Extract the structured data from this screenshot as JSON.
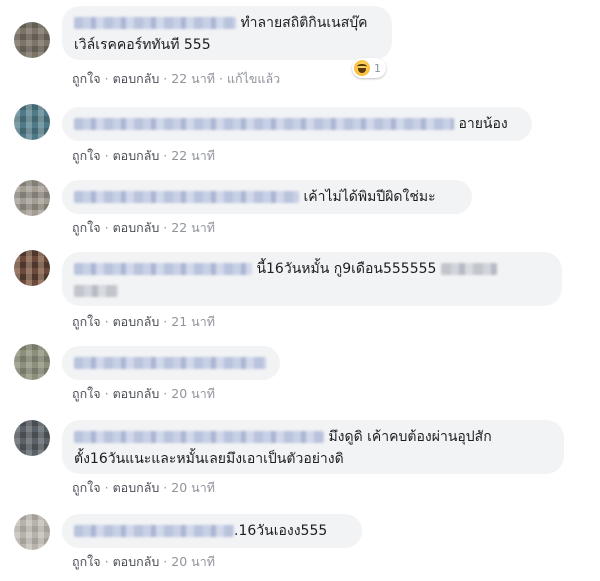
{
  "comments": [
    {
      "text_line1": "ทำลายสถิติกินเนสบุ๊ค",
      "text_line2": "เวิล์เรคคอร์ททันที 555",
      "like": "ถูกใจ",
      "reply": "ตอบกลับ",
      "time": "22 นาที",
      "edited": "แก้ไขแล้ว",
      "reaction_count": "1",
      "reaction_icon": "haha-emoji-icon"
    },
    {
      "text": "อายน้อง",
      "like": "ถูกใจ",
      "reply": "ตอบกลับ",
      "time": "22 นาที"
    },
    {
      "text": "เค้าไม่ได้พิมปีผิดใช่มะ",
      "like": "ถูกใจ",
      "reply": "ตอบกลับ",
      "time": "22 นาที"
    },
    {
      "text": "นี้16วันหมั้น กู9เดือน555555",
      "like": "ถูกใจ",
      "reply": "ตอบกลับ",
      "time": "21 นาที"
    },
    {
      "like": "ถูกใจ",
      "reply": "ตอบกลับ",
      "time": "20 นาที"
    },
    {
      "text_line1": "มึงดูดิ เค้าคบต้องผ่านอุปสัก",
      "text_line2": "ตั้ง16วันแนะและหมั้นเลยมึงเอาเป็นตัวอย่างดิ",
      "like": "ถูกใจ",
      "reply": "ตอบกลับ",
      "time": "20 นาที"
    },
    {
      "text": ".16วันเองง555",
      "like": "ถูกใจ",
      "reply": "ตอบกลับ",
      "time": "20 นาที"
    }
  ],
  "separator": "·"
}
